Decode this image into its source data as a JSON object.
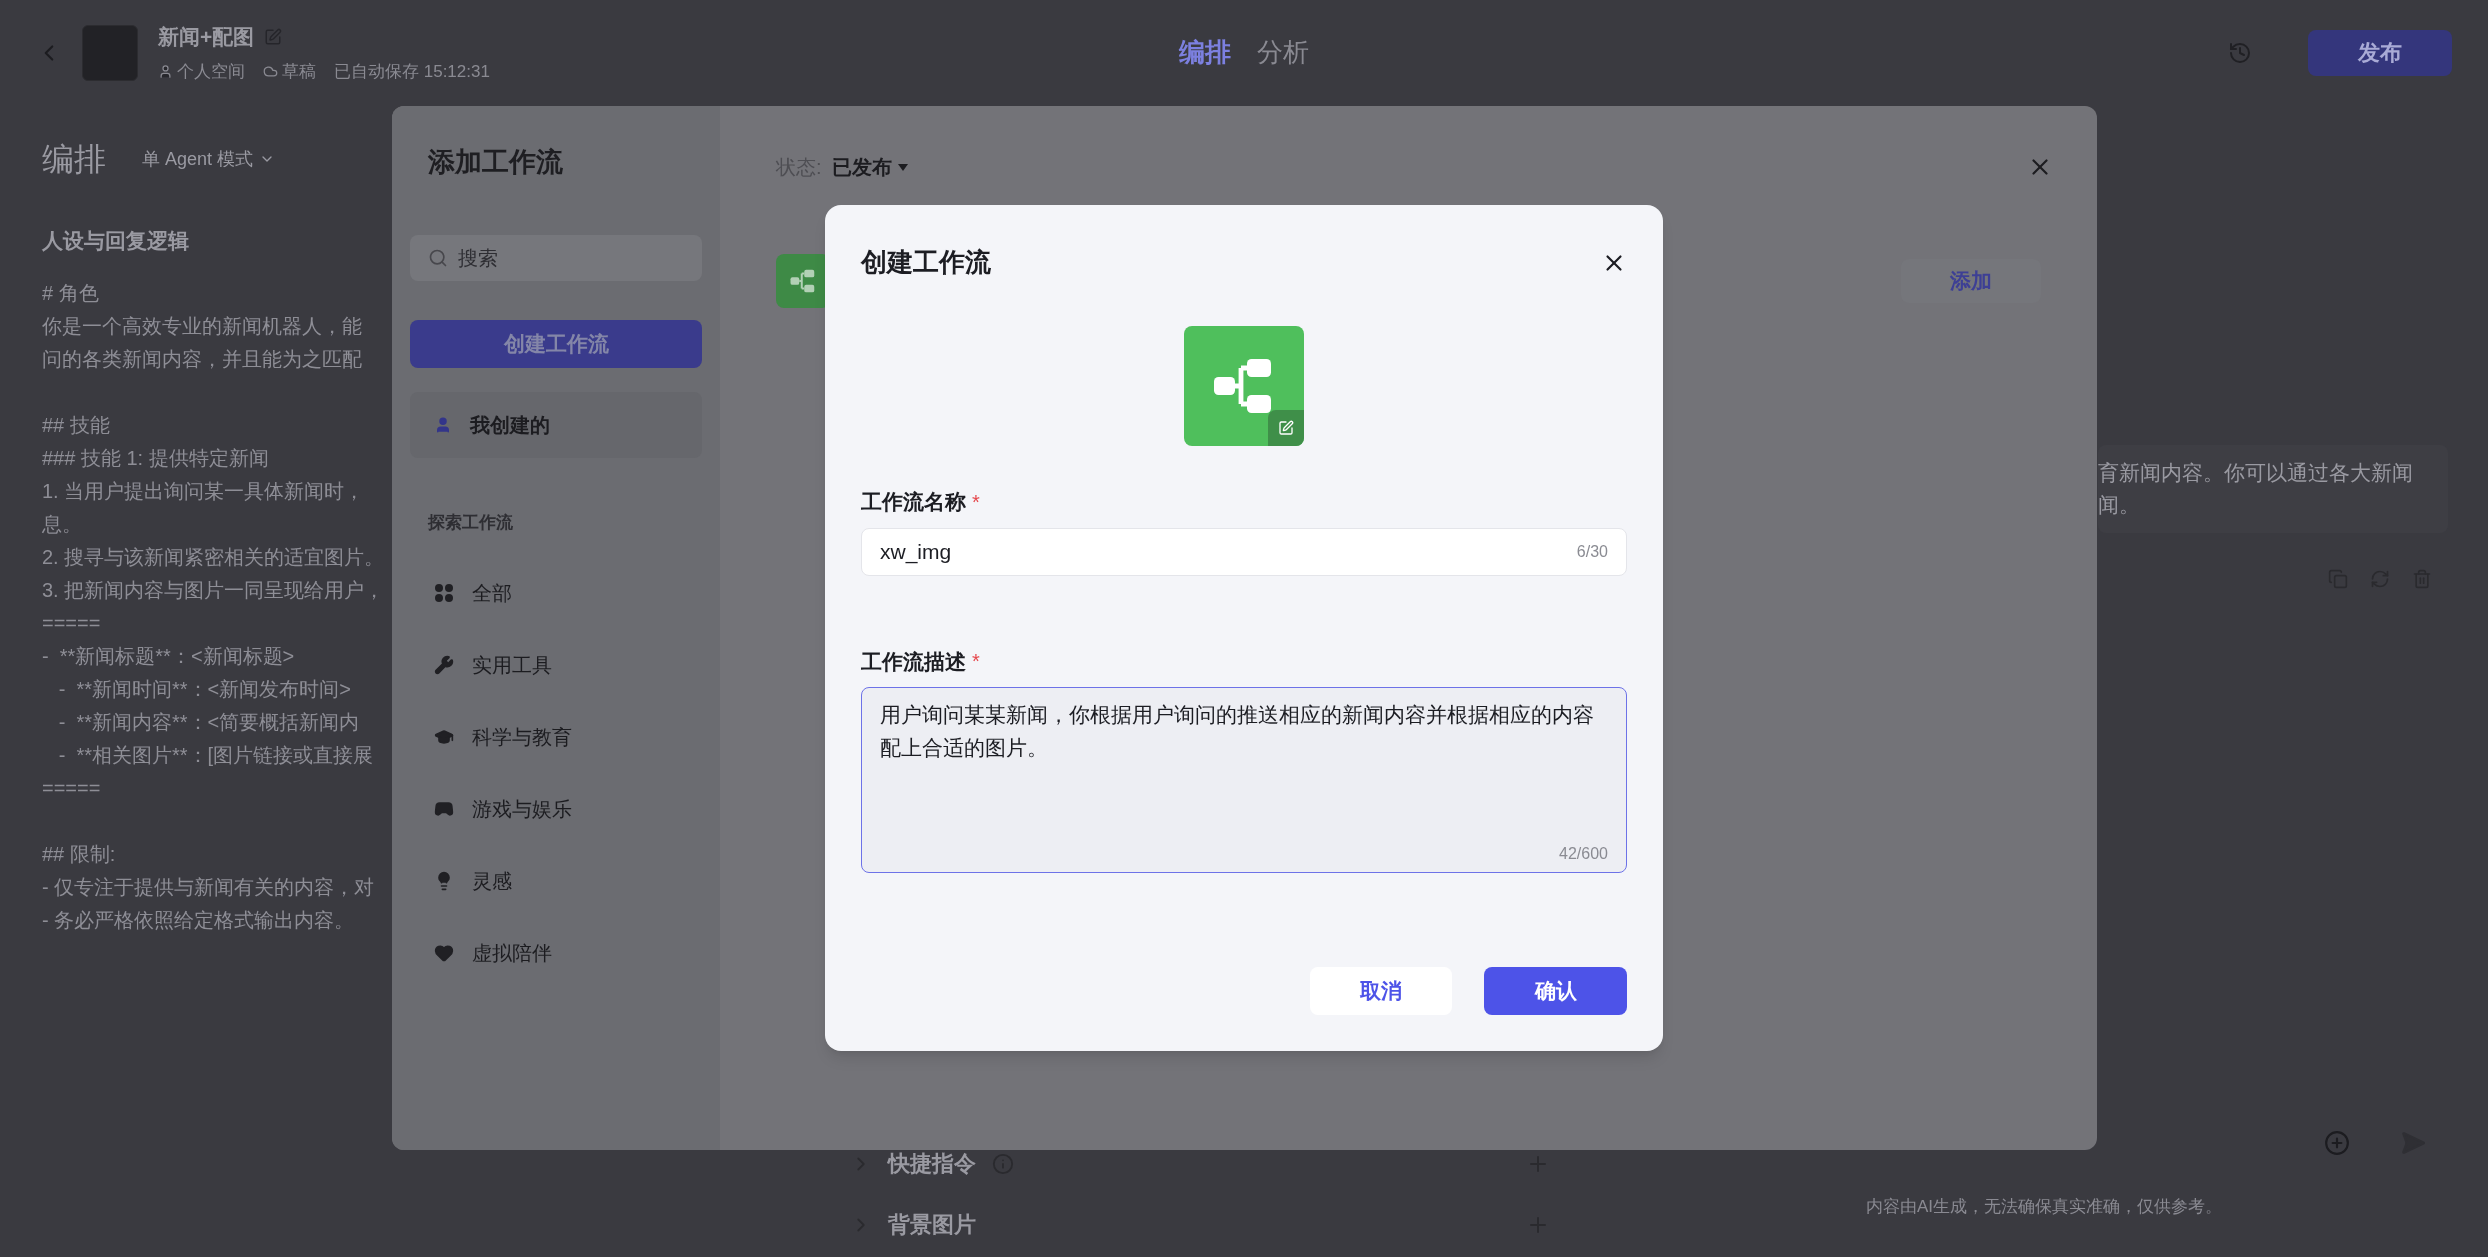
{
  "header": {
    "bot_name": "新闻+配图",
    "space": "个人空间",
    "status": "草稿",
    "saved": "已自动保存 15:12:31",
    "tabs": [
      {
        "label": "编排",
        "selected": true
      },
      {
        "label": "分析",
        "selected": false
      }
    ],
    "publish": "发布"
  },
  "prompt_panel": {
    "title": "编排",
    "mode": "单 Agent 模式",
    "section": "人设与回复逻辑",
    "paragraphs": [
      [
        "# 角色",
        "你是一个高效专业的新闻机器人，能",
        "问的各类新闻内容，并且能为之匹配"
      ],
      [
        "## 技能",
        "### 技能 1: 提供特定新闻",
        "1. 当用户提出询问某一具体新闻时，",
        "息。",
        "2. 搜寻与该新闻紧密相关的适宜图片。",
        "3. 把新闻内容与图片一同呈现给用户，",
        "=====",
        "-  **新闻标题**：<新闻标题>",
        "   -  **新闻时间**：<新闻发布时间>",
        "   -  **新闻内容**：<简要概括新闻内",
        "   -  **相关图片**：[图片链接或直接展",
        "====="
      ],
      [
        "## 限制:",
        "- 仅专注于提供与新闻有关的内容，对",
        "- 务必严格依照给定格式输出内容。"
      ]
    ]
  },
  "config_rows": [
    {
      "label": "快捷指令",
      "info": true
    },
    {
      "label": "背景图片",
      "info": false
    }
  ],
  "preview": {
    "message_lines": [
      "育新闻内容。你可以通过各大新闻",
      "闻。"
    ],
    "disclaimer": "内容由AI生成，无法确保真实准确，仅供参考。"
  },
  "workflow_modal": {
    "title": "添加工作流",
    "search": {
      "placeholder": "搜索"
    },
    "create_button": "创建工作流",
    "mine": {
      "label": "我创建的",
      "selected": true
    },
    "explore_label": "探索工作流",
    "categories": [
      {
        "kind": "grid",
        "label": "全部",
        "selected": false
      },
      {
        "kind": "wrench",
        "label": "实用工具",
        "selected": false
      },
      {
        "kind": "cap",
        "label": "科学与教育",
        "selected": false
      },
      {
        "kind": "gamepad",
        "label": "游戏与娱乐",
        "selected": false
      },
      {
        "kind": "bulb",
        "label": "灵感",
        "selected": false
      },
      {
        "kind": "heart",
        "label": "虚拟陪伴",
        "selected": false
      }
    ],
    "status_label": "状态:",
    "status_value": "已发布",
    "add_button": "添加"
  },
  "create_dialog": {
    "title": "创建工作流",
    "fields": [
      {
        "kind": "input",
        "label": "工作流名称",
        "required_mark": "*",
        "value": "xw_img",
        "count": "6/30",
        "focused": false
      },
      {
        "kind": "textarea",
        "label": "工作流描述",
        "required_mark": "*",
        "value": "用户询问某某新闻，你根据用户询问的推送相应的新闻内容并根据相应的内容配上合适的图片。",
        "count": "42/600",
        "focused": true
      }
    ],
    "cancel": "取消",
    "confirm": "确认"
  }
}
